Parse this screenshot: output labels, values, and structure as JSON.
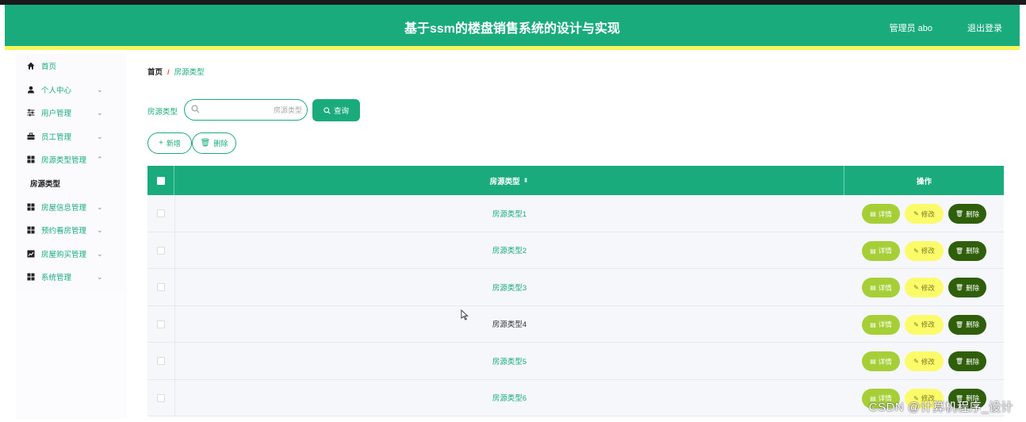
{
  "header": {
    "title": "基于ssm的楼盘销售系统的设计与实现",
    "user": "管理员 abo",
    "logout": "退出登录"
  },
  "sidebar": {
    "items": [
      {
        "label": "首页",
        "icon": "home-icon",
        "has_chevron": false
      },
      {
        "label": "个人中心",
        "icon": "user-icon",
        "has_chevron": true
      },
      {
        "label": "用户管理",
        "icon": "sliders-icon",
        "has_chevron": true
      },
      {
        "label": "员工管理",
        "icon": "briefcase-icon",
        "has_chevron": true
      },
      {
        "label": "房源类型管理",
        "icon": "grid-icon",
        "has_chevron": true
      },
      {
        "label": "房源类型",
        "sub": true
      },
      {
        "label": "房屋信息管理",
        "icon": "grid-icon",
        "has_chevron": true
      },
      {
        "label": "预约看房管理",
        "icon": "grid-icon",
        "has_chevron": true
      },
      {
        "label": "房屋购买管理",
        "icon": "chart-icon",
        "has_chevron": true
      },
      {
        "label": "系统管理",
        "icon": "grid-icon",
        "has_chevron": true
      }
    ]
  },
  "breadcrumb": {
    "home": "首页",
    "separator": "/",
    "current": "房源类型"
  },
  "search": {
    "label": "房源类型",
    "placeholder": "房源类型",
    "value": "",
    "button": "查询"
  },
  "toolbar": {
    "add": "新增",
    "delete": "删除"
  },
  "table": {
    "columns": {
      "type": "房源类型",
      "actions": "操作"
    },
    "rows": [
      {
        "name": "房源类型1"
      },
      {
        "name": "房源类型2"
      },
      {
        "name": "房源类型3"
      },
      {
        "name": "房源类型4"
      },
      {
        "name": "房源类型5"
      },
      {
        "name": "房源类型6"
      }
    ],
    "row_actions": {
      "detail": "详情",
      "edit": "修改",
      "delete": "删除"
    }
  },
  "watermark": "CSDN @计算机程序_设计",
  "colors": {
    "primary": "#1aab7d",
    "accent": "#f5f55a",
    "detail": "#a6cf37",
    "edit": "#fbfb6a",
    "delete": "#2f5f0a"
  }
}
